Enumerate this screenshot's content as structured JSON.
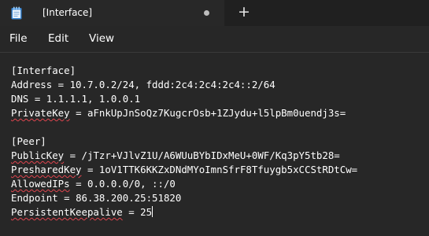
{
  "tab": {
    "title": "[Interface]",
    "modified_icon": "modified-dot-icon",
    "app_icon": "notepad-icon"
  },
  "new_tab_label": "+",
  "menu": {
    "file": "File",
    "edit": "Edit",
    "view": "View"
  },
  "editor": {
    "lines": [
      {
        "key": "[Interface]",
        "rest": ""
      },
      {
        "key": "Address",
        "rest": " = 10.7.0.2/24, fddd:2c4:2c4:2c4::2/64"
      },
      {
        "key": "DNS",
        "rest": " = 1.1.1.1, 1.0.0.1"
      },
      {
        "key": "PrivateKey",
        "rest": " = aFnkUpJnSoQz7KugcrOsb+1ZJydu+l5lpBm0uendj3s="
      },
      {
        "key": "",
        "rest": ""
      },
      {
        "key": "[Peer]",
        "rest": ""
      },
      {
        "key": "PublicKey",
        "rest": " = /jTzr+VJlvZ1U/A6WUuBYbIDxMeU+0WF/Kq3pY5tb28="
      },
      {
        "key": "PresharedKey",
        "rest": " = 1oV1TTK6KKZxDNdMYoImnSfrF8Tfuygb5xCCStRDtCw="
      },
      {
        "key": "AllowedIPs",
        "rest": " = 0.0.0.0/0, ::/0"
      },
      {
        "key": "Endpoint",
        "rest": " = 86.38.200.25:51820"
      },
      {
        "key": "PersistentKeepalive",
        "rest": " = 25"
      }
    ]
  },
  "colors": {
    "background": "#272727",
    "titlebar": "#202020",
    "spellcheck": "#e0454f",
    "text": "#ffffff"
  }
}
